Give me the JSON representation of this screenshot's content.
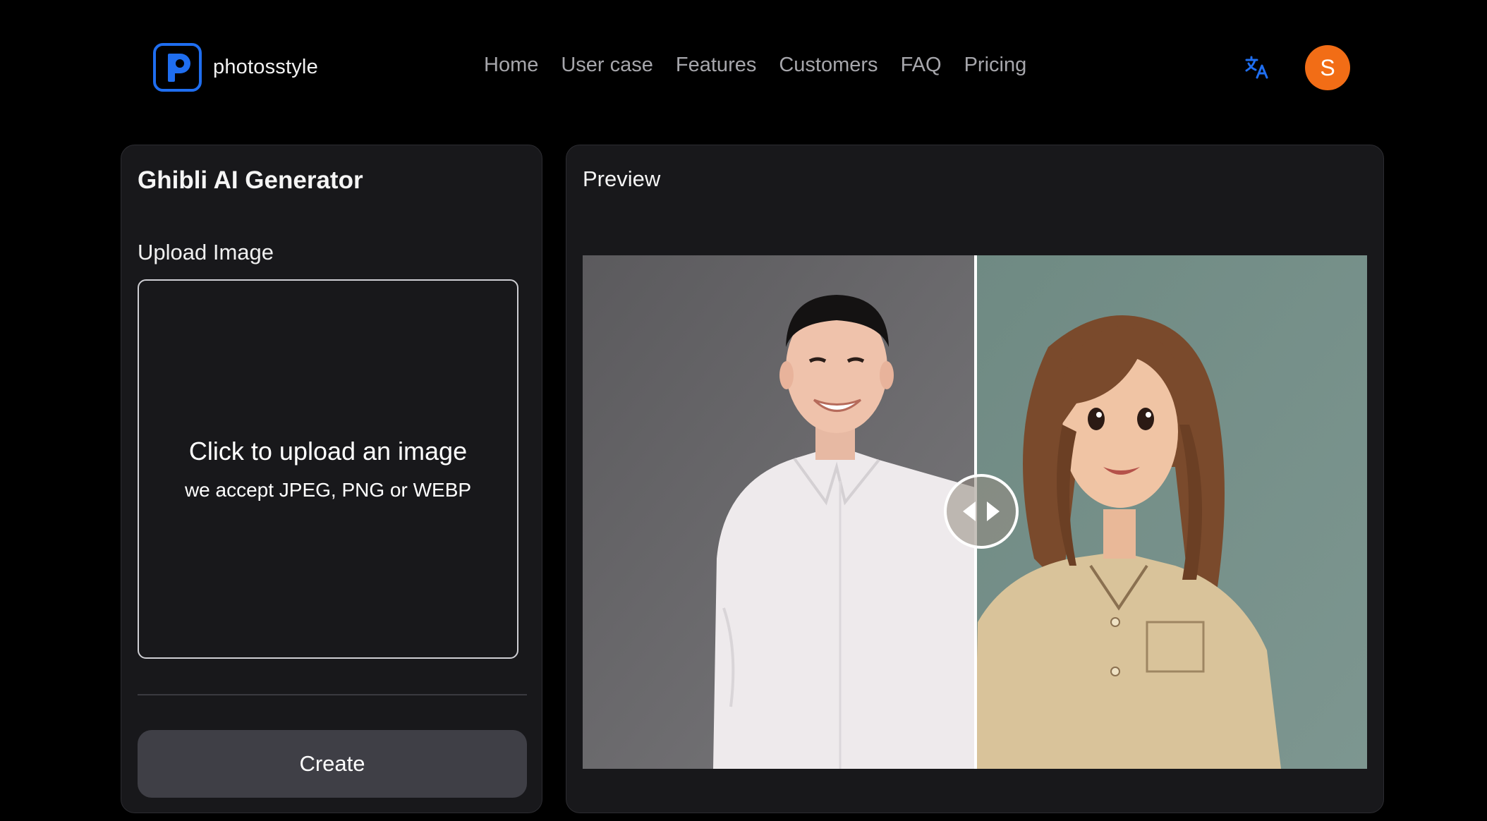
{
  "brand": {
    "logo_letter": "p",
    "name": "photosstyle",
    "accent_color": "#1f6ef0"
  },
  "nav": {
    "items": [
      "Home",
      "User case",
      "Features",
      "Customers",
      "FAQ",
      "Pricing"
    ]
  },
  "header": {
    "translate_icon": "translate-icon",
    "avatar_letter": "S",
    "avatar_color": "#f26d16"
  },
  "generator": {
    "title": "Ghibli AI Generator",
    "upload_label": "Upload Image",
    "dropzone_title": "Click to upload an image",
    "dropzone_subtitle": "we accept JPEG, PNG or WEBP",
    "create_label": "Create"
  },
  "preview": {
    "title": "Preview",
    "compare_handle_icon": "left-right-arrows-icon"
  }
}
